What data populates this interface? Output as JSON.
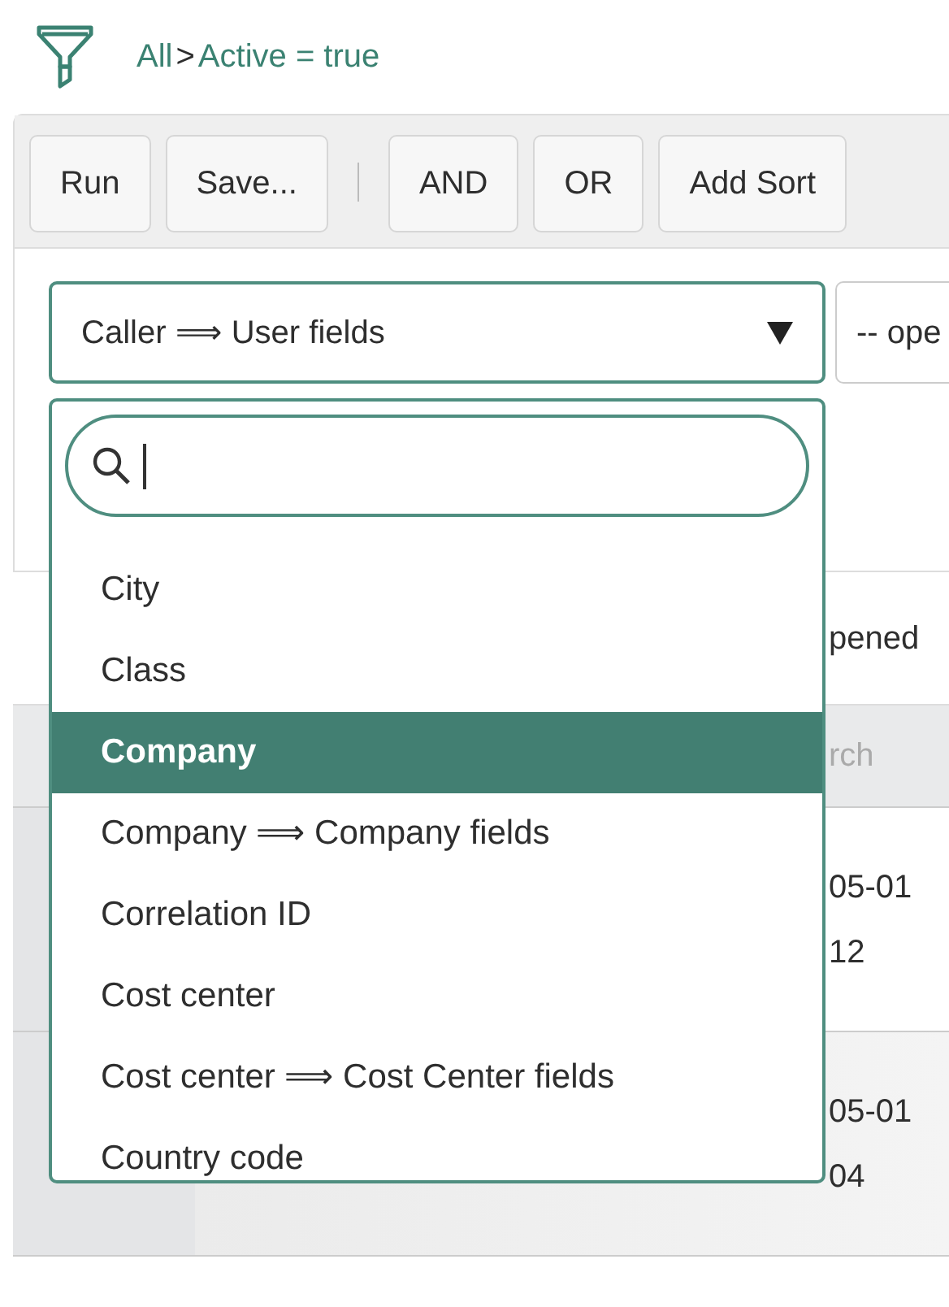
{
  "breadcrumb": [
    {
      "kind": "link",
      "text": "All"
    },
    {
      "kind": "separator",
      "text": ">"
    },
    {
      "kind": "link",
      "text": "Active = true"
    }
  ],
  "toolbar": [
    {
      "kind": "button",
      "label": "Run"
    },
    {
      "kind": "button",
      "label": "Save..."
    },
    {
      "kind": "separator"
    },
    {
      "kind": "button",
      "label": "AND"
    },
    {
      "kind": "button",
      "label": "OR"
    },
    {
      "kind": "button",
      "label": "Add Sort"
    }
  ],
  "condition": {
    "field": "Caller ⟹ User fields",
    "operator": "-- ope"
  },
  "field_menu": {
    "items": [
      {
        "label": "City",
        "selected": false
      },
      {
        "label": "Class",
        "selected": false
      },
      {
        "label": "Company",
        "selected": true
      },
      {
        "label": "Company ⟹ Company fields",
        "selected": false
      },
      {
        "label": "Correlation ID",
        "selected": false
      },
      {
        "label": "Cost center",
        "selected": false
      },
      {
        "label": "Cost center ⟹ Cost Center fields",
        "selected": false
      },
      {
        "label": "Country code",
        "selected": false
      }
    ]
  },
  "list": {
    "column_header": "pened",
    "search_placeholder": "rch",
    "rows": [
      {
        "lines": [
          "05-01",
          "12"
        ],
        "shaded": false
      },
      {
        "lines": [
          "05-01",
          "04"
        ],
        "shaded": true
      }
    ]
  }
}
